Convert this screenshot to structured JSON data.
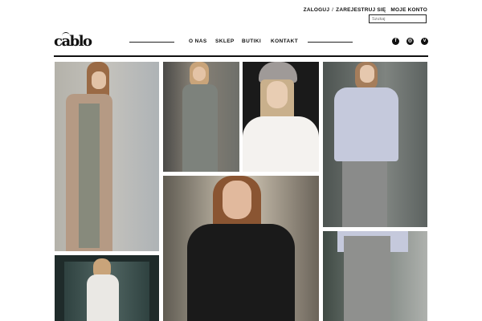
{
  "header": {
    "login": "ZALOGUJ",
    "sep": "/",
    "register": "ZAREJESTRUJ SIĘ",
    "account": "MOJE KONTO",
    "search_placeholder": "Szukaj",
    "logo": "cablo"
  },
  "nav": {
    "items": [
      "O NAS",
      "SKLEP",
      "BUTIKI",
      "KONTAKT"
    ]
  },
  "social": {
    "icons": [
      "facebook-icon",
      "instagram-icon",
      "vimeo-icon"
    ],
    "glyphs": [
      "f",
      "◎",
      "v"
    ]
  },
  "colors": {
    "text": "#111111",
    "divider": "#111111"
  }
}
